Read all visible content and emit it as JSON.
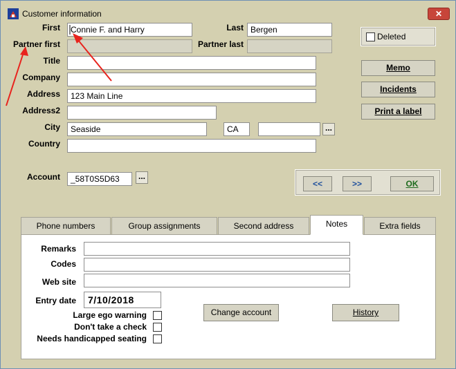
{
  "window": {
    "title": "Customer information",
    "close_label": "✕"
  },
  "labels": {
    "first": "First",
    "last": "Last",
    "partner_first": "Partner first",
    "partner_last": "Partner last",
    "title": "Title",
    "company": "Company",
    "address": "Address",
    "address2": "Address2",
    "city": "City",
    "country": "Country",
    "account": "Account"
  },
  "fields": {
    "first": "Connie F. and Harry",
    "last": "Bergen",
    "partner_first": "",
    "partner_last": "",
    "title": "",
    "company": "",
    "address": "123 Main Line",
    "address2": "",
    "city": "Seaside",
    "state": "CA",
    "zip": "",
    "country": "",
    "account": "_58T0S5D63"
  },
  "deleted": {
    "label": "Deleted",
    "checked": false
  },
  "side_buttons": {
    "memo": "Memo",
    "incidents": "Incidents",
    "print_label": "Print a label"
  },
  "nav": {
    "prev": "<<",
    "next": ">>",
    "ok": "OK"
  },
  "ellipsis": "...",
  "tabs": [
    {
      "label": "Phone numbers",
      "active": false
    },
    {
      "label": "Group assignments",
      "active": false
    },
    {
      "label": "Second address",
      "active": false
    },
    {
      "label": "Notes",
      "active": true
    },
    {
      "label": "Extra fields",
      "active": false
    }
  ],
  "notes": {
    "remarks_label": "Remarks",
    "codes_label": "Codes",
    "website_label": "Web site",
    "entry_date_label": "Entry date",
    "remarks": "",
    "codes": "",
    "website": "",
    "entry_date": "7/10/2018",
    "change_account": "Change account",
    "history": "History",
    "checkboxes": [
      {
        "label": "Large ego warning",
        "checked": false
      },
      {
        "label": "Don't take a check",
        "checked": false
      },
      {
        "label": "Needs handicapped seating",
        "checked": false
      }
    ]
  },
  "colors": {
    "annotation_arrow": "#e8231d",
    "window_bg": "#d4d0b0",
    "close_button": "#c7453a",
    "nav_text": "#1e4f9c"
  }
}
